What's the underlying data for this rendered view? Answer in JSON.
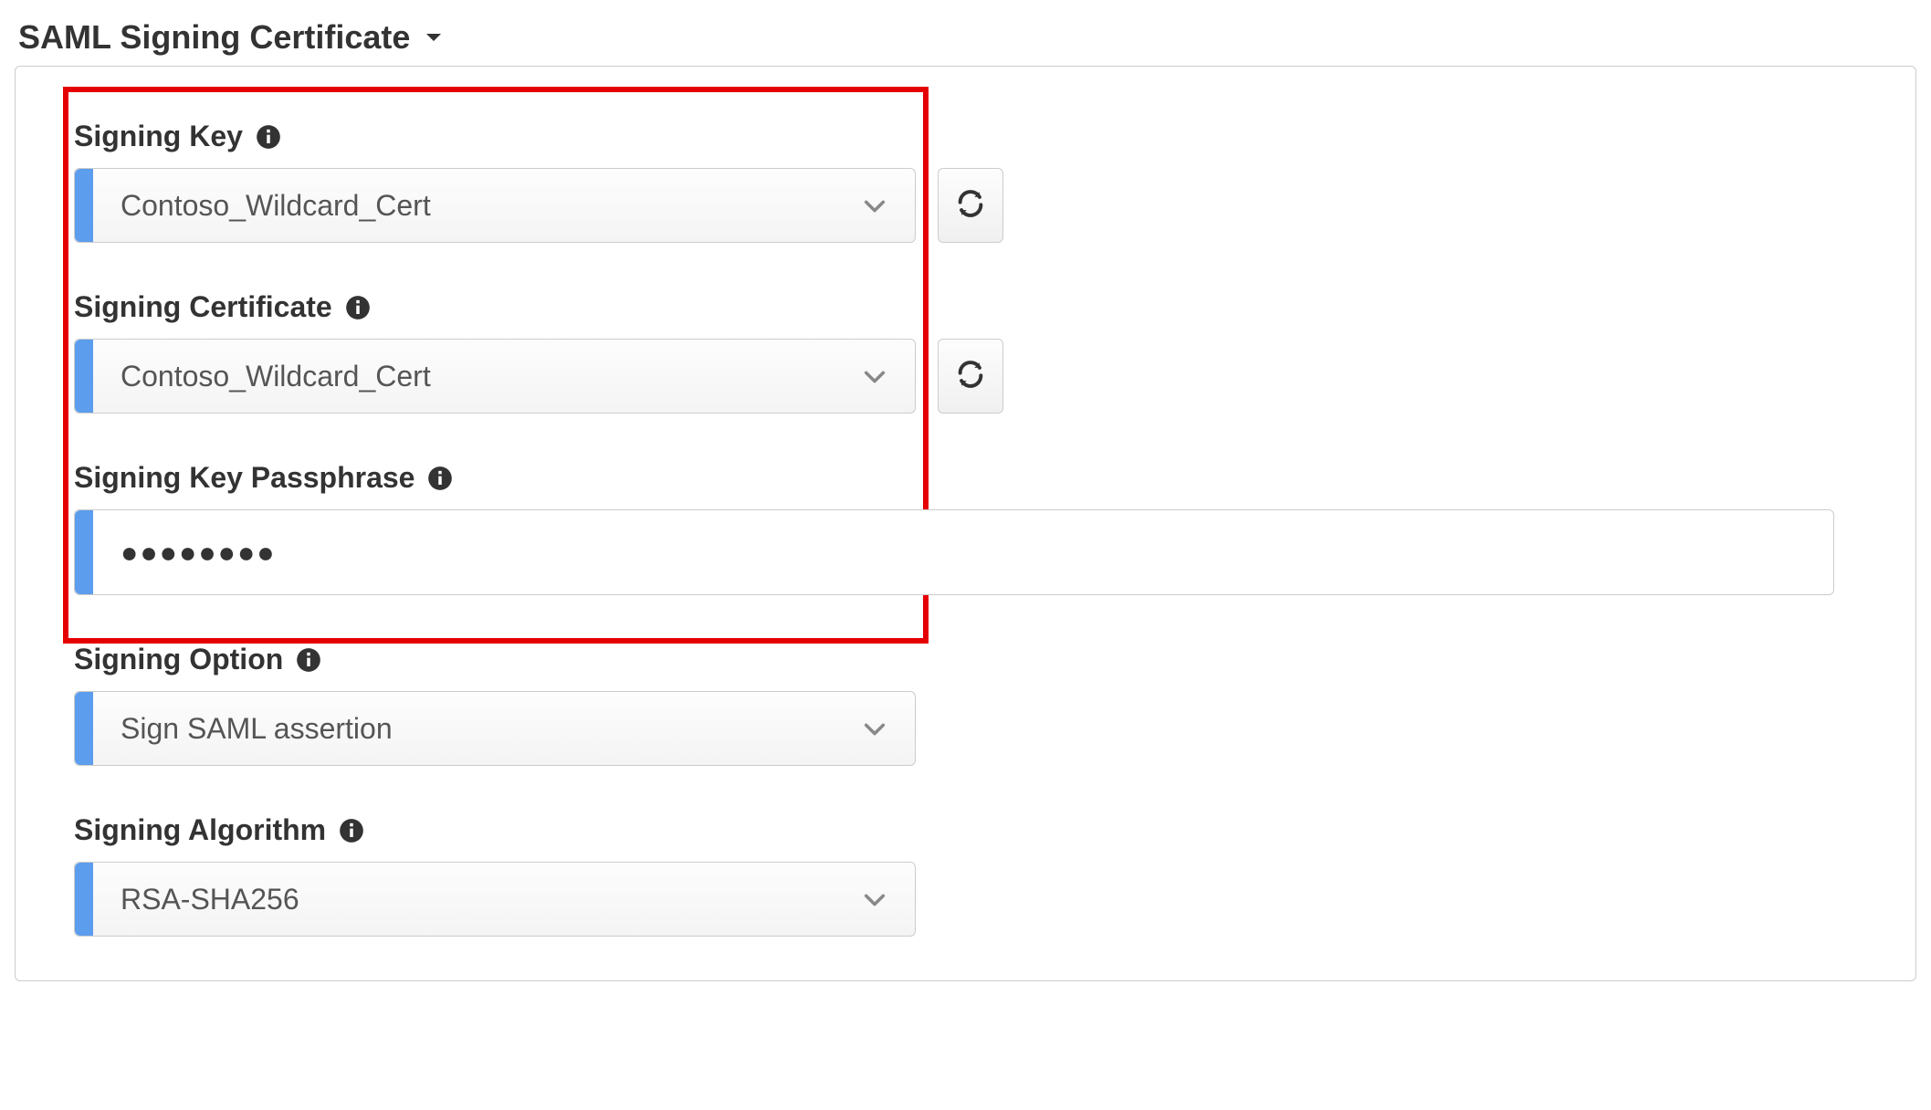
{
  "section": {
    "title": "SAML Signing Certificate"
  },
  "fields": {
    "signing_key": {
      "label": "Signing Key",
      "value": "Contoso_Wildcard_Cert"
    },
    "signing_certificate": {
      "label": "Signing Certificate",
      "value": "Contoso_Wildcard_Cert"
    },
    "signing_key_passphrase": {
      "label": "Signing Key Passphrase",
      "value": "●●●●●●●●"
    },
    "signing_option": {
      "label": "Signing Option",
      "value": "Sign SAML assertion"
    },
    "signing_algorithm": {
      "label": "Signing Algorithm",
      "value": "RSA-SHA256"
    }
  }
}
